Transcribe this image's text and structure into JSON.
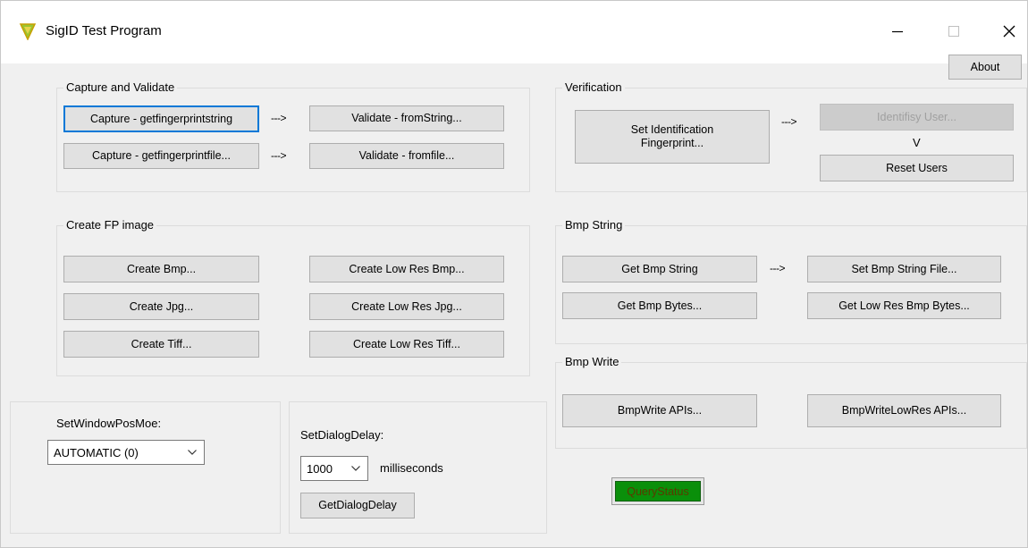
{
  "window": {
    "title": "SigID Test Program",
    "minimize_icon": "minimize-icon",
    "maximize_icon": "maximize-icon",
    "close_icon": "close-icon"
  },
  "about_label": "About",
  "capture_validate": {
    "title": "Capture and Validate",
    "capture_string_label": "Capture - getfingerprintstring",
    "capture_file_label": "Capture - getfingerprintfile...",
    "arrow": "--->",
    "validate_string_label": "Validate - fromString...",
    "validate_file_label": "Validate - fromfile..."
  },
  "verification": {
    "title": "Verification",
    "set_identification_label": "Set Identification Fingerprint...",
    "arrow": "--->",
    "identify_user_label": "Identifisy User...",
    "down_marker": "V",
    "reset_users_label": "Reset Users"
  },
  "create_fp": {
    "title": "Create FP image",
    "create_bmp_label": "Create Bmp...",
    "create_jpg_label": "Create Jpg...",
    "create_tiff_label": "Create Tiff...",
    "create_low_bmp_label": "Create Low Res Bmp...",
    "create_low_jpg_label": "Create Low Res Jpg...",
    "create_low_tiff_label": "Create Low Res Tiff..."
  },
  "bmp_string": {
    "title": "Bmp String",
    "get_string_label": "Get Bmp String",
    "arrow": "--->",
    "set_string_file_label": "Set Bmp String File...",
    "get_bytes_label": "Get Bmp Bytes...",
    "get_low_bytes_label": "Get Low Res Bmp Bytes..."
  },
  "bmp_write": {
    "title": "Bmp Write",
    "write_apis_label": "BmpWrite APIs...",
    "write_low_apis_label": "BmpWriteLowRes APIs..."
  },
  "window_pos": {
    "label": "SetWindowPosMoe:",
    "selected": "AUTOMATIC (0)"
  },
  "dialog_delay": {
    "label": "SetDialogDelay:",
    "selected": "1000",
    "unit": "milliseconds",
    "get_label": "GetDialogDelay"
  },
  "status": {
    "label": "QueryStatus",
    "color": "#0a8f0a"
  }
}
